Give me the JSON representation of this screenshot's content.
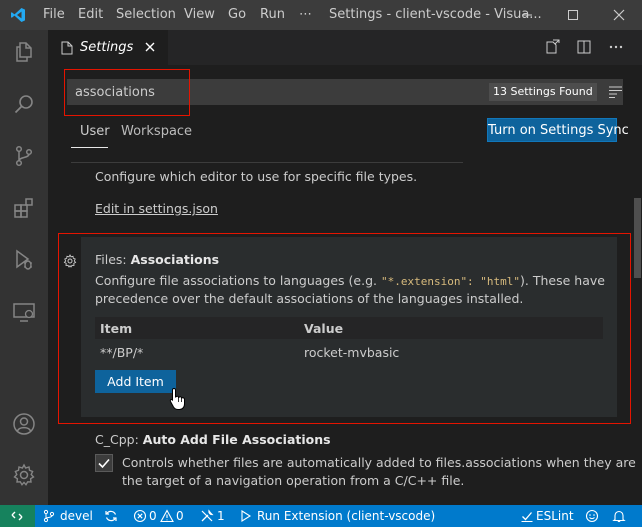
{
  "titlebar": {
    "menu": [
      "File",
      "Edit",
      "Selection",
      "View",
      "Go",
      "Run",
      "⋯"
    ],
    "title": "Settings - client-vscode - Visua..."
  },
  "tab": {
    "label": "Settings"
  },
  "search": {
    "value": "associations",
    "results_badge": "13 Settings Found"
  },
  "scopes": {
    "user": "User",
    "workspace": "Workspace"
  },
  "sync_button": "Turn on Settings Sync",
  "editor_assoc": {
    "description": "Configure which editor to use for specific file types.",
    "link": "Edit in settings.json"
  },
  "files_associations": {
    "category": "Files: ",
    "key": "Associations",
    "desc_before": "Configure file associations to languages (e.g. ",
    "code_ext": "\"*.extension\": \"html\"",
    "desc_after": "). These have",
    "desc_line2": "precedence over the default associations of the languages installed.",
    "table": {
      "headers": [
        "Item",
        "Value"
      ],
      "rows": [
        {
          "item": "**/BP/*",
          "value": "rocket-mvbasic"
        }
      ]
    },
    "add_button": "Add Item"
  },
  "cpp_assoc": {
    "category": "C_Cpp: ",
    "key": "Auto Add File Associations",
    "checked": true,
    "desc_line1": "Controls whether files are automatically added to files.associations when they are",
    "desc_line2": "the target of a navigation operation from a C/C++ file."
  },
  "statusbar": {
    "branch": "devel",
    "errors": "0",
    "warnings": "0",
    "tools": "1",
    "run": "Run Extension (client-vscode)",
    "eslint": "ESLint"
  },
  "colors": {
    "accent": "#007acc",
    "highlight_box": "#e51400",
    "button": "#0e639c",
    "remote": "#16825d"
  }
}
